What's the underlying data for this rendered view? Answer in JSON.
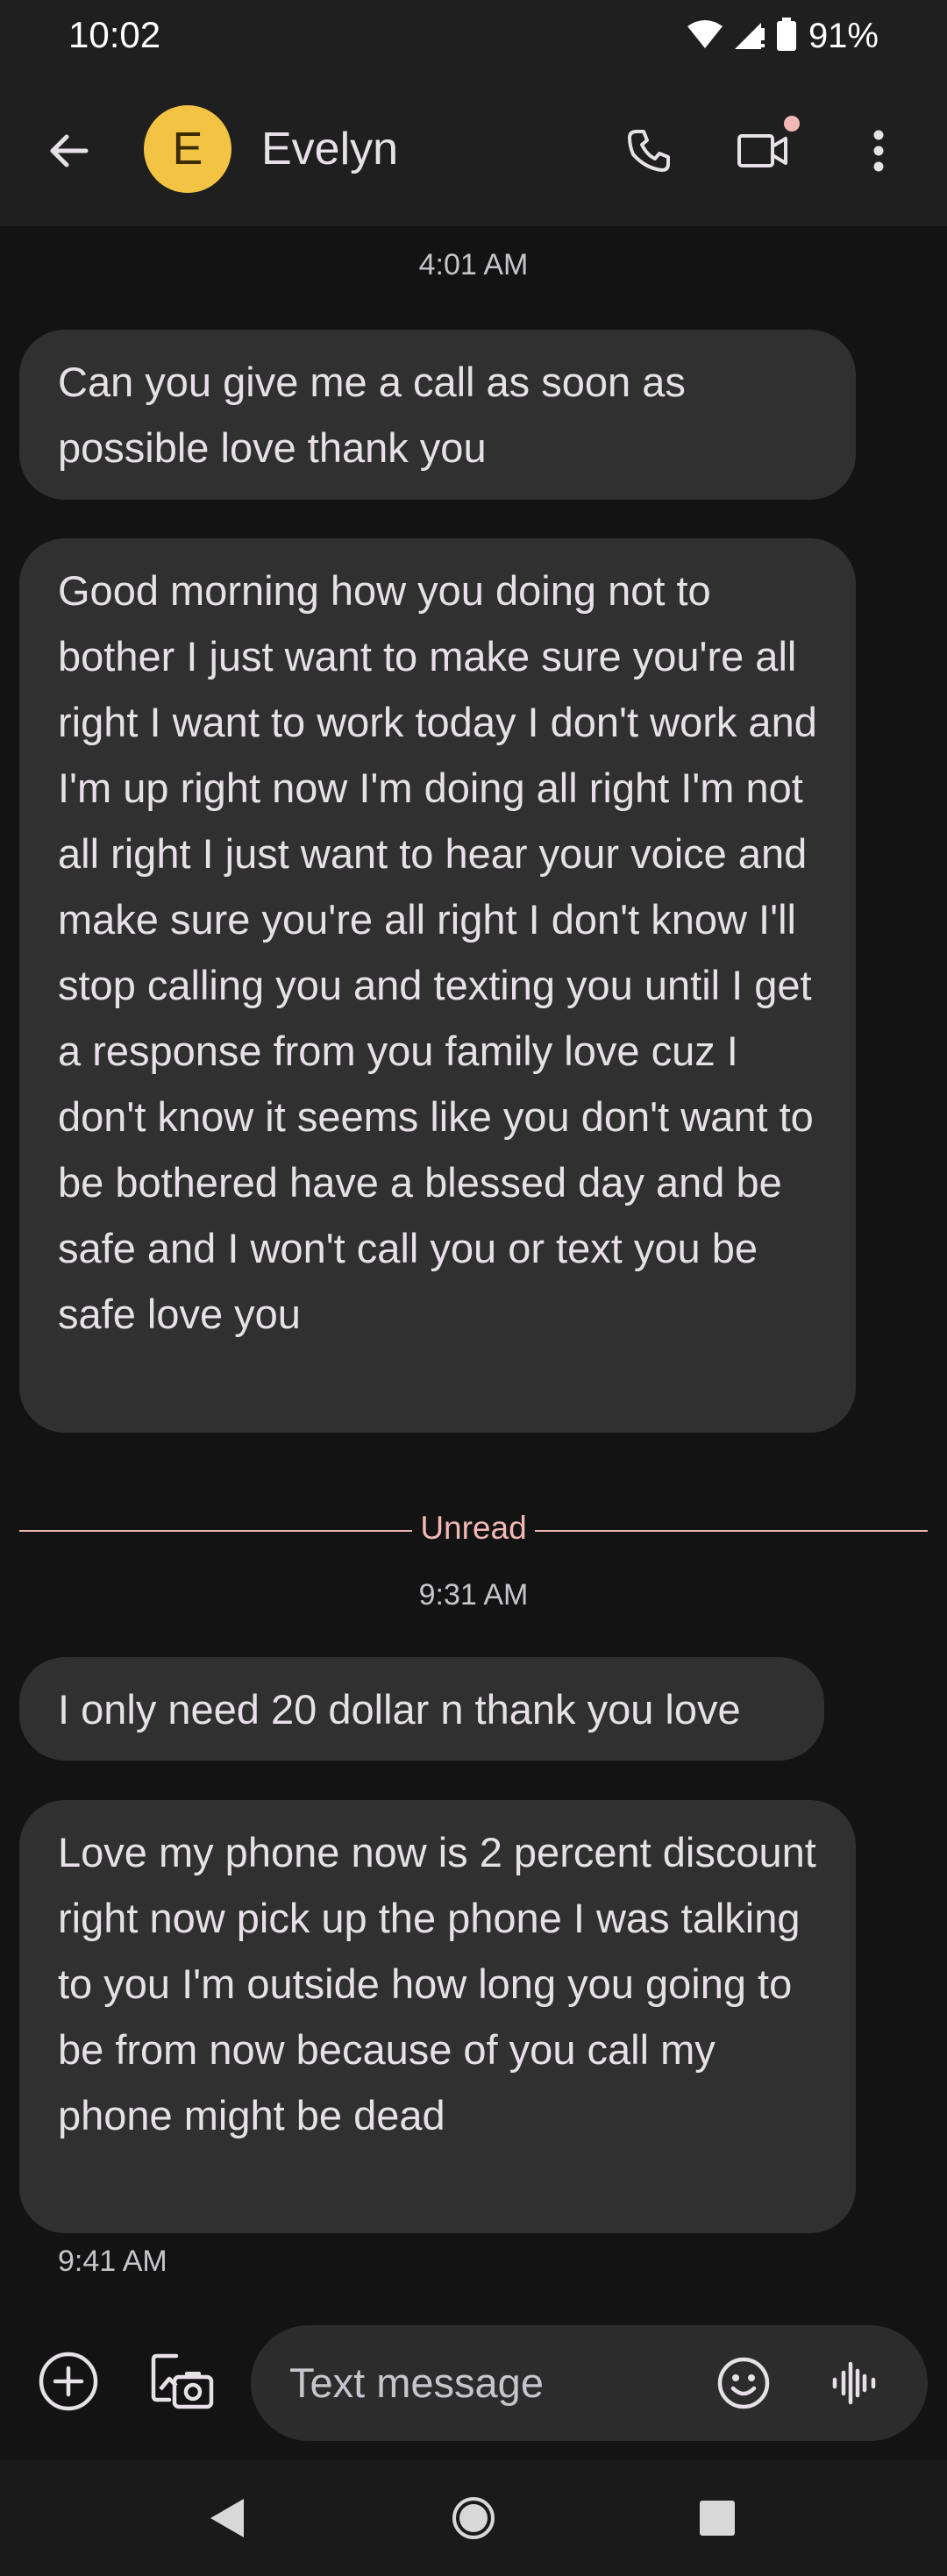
{
  "status_bar": {
    "time": "10:02",
    "battery": "91%",
    "icons": [
      "wifi-icon",
      "cell-signal-icon",
      "battery-icon"
    ]
  },
  "header": {
    "contact_initial": "E",
    "contact_name": "Evelyn",
    "avatar_color": "#f3c443",
    "actions": [
      "back-arrow-icon",
      "phone-icon",
      "video-call-icon",
      "more-vert-icon"
    ]
  },
  "conversation": {
    "timestamp_1": "4:01 AM",
    "messages_1": [
      "Can you give me a call as soon as possible love thank you",
      "Good morning how you doing not to bother I just want to make sure you're all right I want to work today I don't work and I'm up right now I'm doing all right I'm not all right I just want to hear your voice and make sure you're all right I don't know I'll stop calling you and texting you until I get a response from you family love cuz I don't know it seems like you don't want to be bothered have a blessed day and be safe and I won't call you or text you be safe love you"
    ],
    "unread_label": "Unread",
    "timestamp_2": "9:31 AM",
    "messages_2": [
      "I only need 20 dollar n thank you love",
      "Love my phone now is 2 percent discount right now pick up the phone I was talking to you I'm outside how long you going to be from now because of you call my phone might be dead"
    ],
    "last_message_time": "9:41 AM"
  },
  "composer": {
    "placeholder": "Text message",
    "icons": [
      "add-circle-icon",
      "gallery-camera-icon",
      "emoji-icon",
      "voice-waveform-icon"
    ]
  },
  "nav_bar": {
    "icons": [
      "nav-back-icon",
      "nav-home-icon",
      "nav-recents-icon"
    ]
  },
  "colors": {
    "background": "#131313",
    "bubble": "#303030",
    "unread_accent": "#f2b8b5"
  }
}
